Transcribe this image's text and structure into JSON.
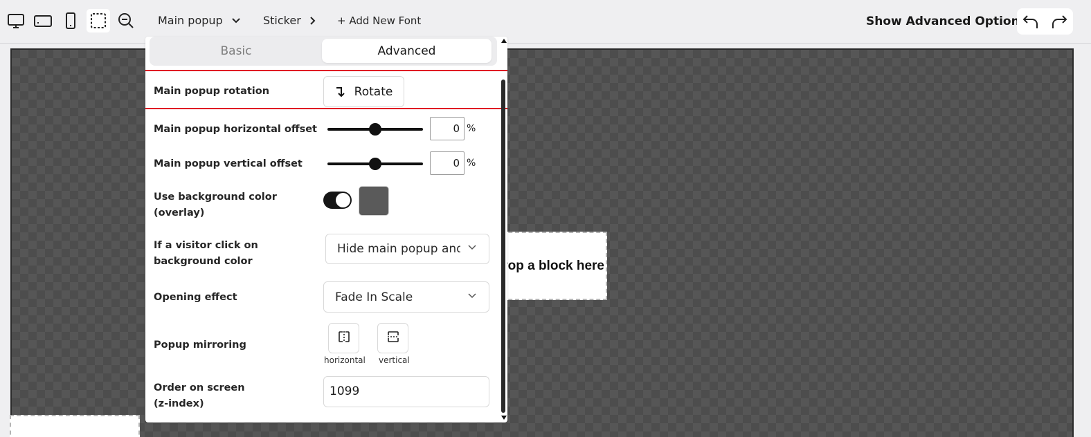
{
  "toolbar": {
    "icons": [
      {
        "name": "desktop-view-icon"
      },
      {
        "name": "tablet-landscape-view-icon"
      },
      {
        "name": "mobile-view-icon"
      },
      {
        "name": "selection-mode-icon"
      },
      {
        "name": "zoom-out-icon"
      }
    ],
    "popup_selector": "Main popup",
    "sticker_label": "Sticker",
    "add_font_label": "+ Add New Font",
    "advanced_options_label": "Show Advanced Options"
  },
  "panel": {
    "tabs": {
      "basic": "Basic",
      "advanced": "Advanced",
      "active": "Advanced"
    },
    "rotation": {
      "label": "Main popup rotation",
      "button_label": "Rotate"
    },
    "horizontal_offset": {
      "label": "Main popup horizontal offset",
      "value": "0",
      "unit": "%",
      "slider_value": 0.5
    },
    "vertical_offset": {
      "label": "Main popup vertical offset",
      "value": "0",
      "unit": "%",
      "slider_value": 0.5
    },
    "background": {
      "label_line1": "Use background color",
      "label_line2": "(overlay)",
      "toggle_on": true,
      "swatch_color": "#5a5a5a"
    },
    "click_background": {
      "label_line1": "If a visitor click on",
      "label_line2": "background color",
      "selected": "Hide main popup and"
    },
    "opening_effect": {
      "label": "Opening effect",
      "selected": "Fade In Scale"
    },
    "mirroring": {
      "label": "Popup mirroring",
      "horizontal_label": "horizontal",
      "vertical_label": "vertical"
    },
    "z_index": {
      "label_line1": "Order on screen",
      "label_line2": "(z-index)",
      "value": "1099"
    }
  },
  "canvas": {
    "drop_text": "Drop a block here"
  },
  "colors": {
    "highlight": "#e01b24",
    "canvas_bg": "#4d4d4d",
    "toggle_on": "#151515"
  }
}
